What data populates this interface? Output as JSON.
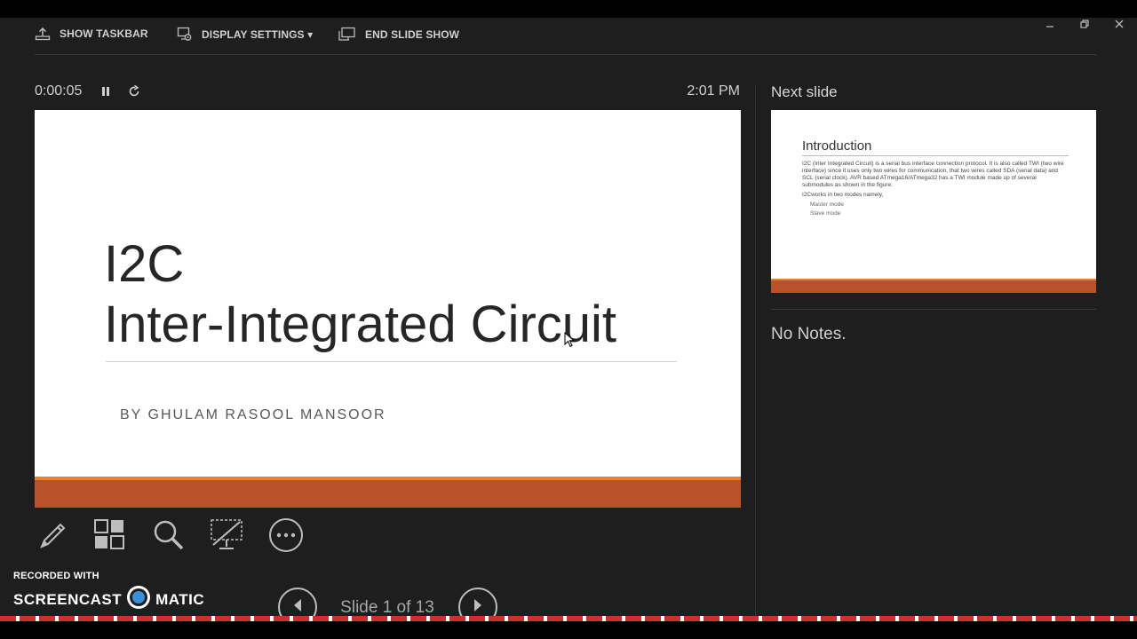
{
  "toolbar": {
    "show_taskbar": "SHOW TASKBAR",
    "display_settings": "DISPLAY SETTINGS ▾",
    "end_slide_show": "END SLIDE SHOW"
  },
  "presenter": {
    "timer": "0:00:05",
    "clock": "2:01 PM",
    "next_slide_label": "Next slide",
    "notes": "No Notes.",
    "slide_counter": "Slide 1 of 13"
  },
  "current_slide": {
    "title_line1": "I2C",
    "title_line2": "Inter-Integrated Circuit",
    "subtitle": "BY GHULAM RASOOL MANSOOR"
  },
  "next_slide": {
    "title": "Introduction",
    "paragraph1": "I2C (Inter Integrated Circuit) is a serial bus interface connection protocol. It is also called TWI (two wire interface) since it uses only two wires for communication, that two wires called SDA (serial data) and SCL (serial clock). AVR based ATmega16/ATmega32 has a TWI module made up of several submodules as shown in the figure.",
    "paragraph2": "I2Cworks in two modes namely,",
    "item1": "Master mode",
    "item2": "Slave mode"
  },
  "watermark": {
    "line1": "RECORDED WITH",
    "brand_left": "SCREENCAST",
    "brand_right": "MATIC"
  },
  "colors": {
    "background": "#1e1e1e",
    "slide_accent": "#b9512a",
    "slide_accent_light": "#e8822f"
  },
  "icons": [
    "taskbar-icon",
    "display-settings-icon",
    "end-show-icon",
    "minimize-icon",
    "restore-icon",
    "close-icon",
    "pause-icon",
    "reset-icon",
    "pen-icon",
    "see-all-slides-icon",
    "zoom-icon",
    "black-screen-icon",
    "more-options-icon",
    "prev-arrow-icon",
    "next-arrow-icon"
  ]
}
